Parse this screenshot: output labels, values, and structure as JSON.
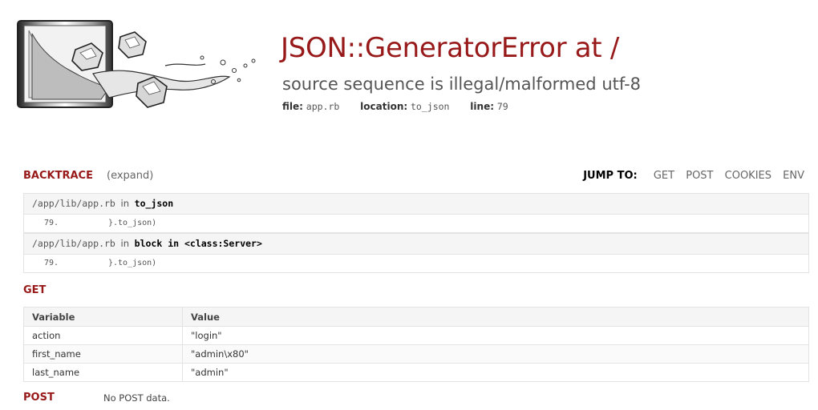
{
  "header": {
    "title": "JSON::GeneratorError at /",
    "subtitle": "source sequence is illegal/malformed utf-8",
    "file_label": "file:",
    "file_value": "app.rb",
    "location_label": "location:",
    "location_value": "to_json",
    "line_label": "line:",
    "line_value": "79"
  },
  "backtrace": {
    "title": "BACKTRACE",
    "expand_label": "(expand)",
    "jump_label": "JUMP TO:",
    "jump_links": [
      "GET",
      "POST",
      "COOKIES",
      "ENV"
    ],
    "frames": [
      {
        "path": "/app/lib/app.rb",
        "in": "in",
        "method": "to_json",
        "line": "79.",
        "code": "}.to_json)"
      },
      {
        "path": "/app/lib/app.rb",
        "in": "in",
        "method": "block in <class:Server>",
        "line": "79.",
        "code": "}.to_json)"
      }
    ]
  },
  "get": {
    "title": "GET",
    "headers": [
      "Variable",
      "Value"
    ],
    "rows": [
      [
        "action",
        "\"login\""
      ],
      [
        "first_name",
        "\"admin\\x80\""
      ],
      [
        "last_name",
        "\"admin\""
      ]
    ]
  },
  "post": {
    "title": "POST",
    "empty_text": "No POST data."
  },
  "colors": {
    "accent": "#981919",
    "row_bg": "#f5f5f5",
    "border": "#e3e3e3"
  },
  "icons": {
    "logo": "sinatra-glass-logo"
  }
}
